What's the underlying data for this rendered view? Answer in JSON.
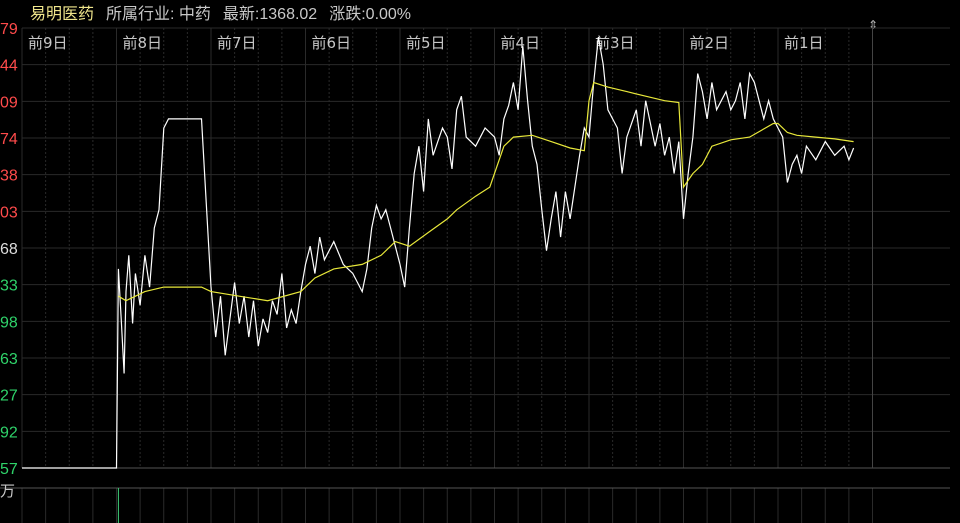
{
  "header": {
    "stock_name": "易明医药",
    "industry": "所属行业: 中药",
    "latest": "最新:1368.02",
    "change": "涨跌:0.00%"
  },
  "volume_unit": "万",
  "icons": {
    "scroll": "up-down-arrow-icon"
  },
  "colors": {
    "price_line": "#ffffff",
    "avg_line": "#e8e83a",
    "axis_up": "#ff4b4b",
    "axis_mid": "#dddddd",
    "axis_down": "#2fd36a",
    "grid": "#2a2a2a",
    "volume_bar": "#3fd17a"
  },
  "chart_data": {
    "type": "line",
    "day_labels": [
      "前9日",
      "前8日",
      "前7日",
      "前6日",
      "前5日",
      "前4日",
      "前3日",
      "前2日",
      "前1日"
    ],
    "y_tick_labels": [
      "79",
      "44",
      "09",
      "74",
      "38",
      "03",
      "68",
      "33",
      "98",
      "63",
      "27",
      "92",
      "57"
    ],
    "series": [
      {
        "key": "price",
        "values": [
          [
            0.0,
            1016
          ],
          [
            0.5,
            1016
          ],
          [
            1.0,
            1016
          ],
          [
            1.02,
            1235
          ],
          [
            1.05,
            1180
          ],
          [
            1.08,
            1120
          ],
          [
            1.1,
            1210
          ],
          [
            1.13,
            1250
          ],
          [
            1.17,
            1175
          ],
          [
            1.2,
            1230
          ],
          [
            1.25,
            1195
          ],
          [
            1.3,
            1250
          ],
          [
            1.35,
            1215
          ],
          [
            1.4,
            1280
          ],
          [
            1.45,
            1300
          ],
          [
            1.5,
            1390
          ],
          [
            1.55,
            1400
          ],
          [
            1.9,
            1400
          ],
          [
            2.0,
            1215
          ],
          [
            2.05,
            1160
          ],
          [
            2.1,
            1205
          ],
          [
            2.15,
            1140
          ],
          [
            2.2,
            1180
          ],
          [
            2.25,
            1220
          ],
          [
            2.3,
            1175
          ],
          [
            2.35,
            1205
          ],
          [
            2.4,
            1160
          ],
          [
            2.45,
            1200
          ],
          [
            2.5,
            1150
          ],
          [
            2.55,
            1180
          ],
          [
            2.6,
            1165
          ],
          [
            2.65,
            1200
          ],
          [
            2.7,
            1185
          ],
          [
            2.75,
            1230
          ],
          [
            2.8,
            1170
          ],
          [
            2.85,
            1190
          ],
          [
            2.9,
            1175
          ],
          [
            2.95,
            1210
          ],
          [
            3.0,
            1240
          ],
          [
            3.05,
            1260
          ],
          [
            3.1,
            1230
          ],
          [
            3.15,
            1270
          ],
          [
            3.2,
            1245
          ],
          [
            3.3,
            1265
          ],
          [
            3.4,
            1240
          ],
          [
            3.5,
            1230
          ],
          [
            3.55,
            1220
          ],
          [
            3.6,
            1210
          ],
          [
            3.65,
            1235
          ],
          [
            3.7,
            1280
          ],
          [
            3.75,
            1305
          ],
          [
            3.8,
            1290
          ],
          [
            3.85,
            1300
          ],
          [
            3.9,
            1280
          ],
          [
            3.95,
            1260
          ],
          [
            4.0,
            1240
          ],
          [
            4.05,
            1215
          ],
          [
            4.1,
            1280
          ],
          [
            4.15,
            1340
          ],
          [
            4.2,
            1370
          ],
          [
            4.25,
            1320
          ],
          [
            4.3,
            1400
          ],
          [
            4.35,
            1360
          ],
          [
            4.4,
            1375
          ],
          [
            4.45,
            1390
          ],
          [
            4.5,
            1380
          ],
          [
            4.55,
            1345
          ],
          [
            4.6,
            1410
          ],
          [
            4.65,
            1425
          ],
          [
            4.7,
            1380
          ],
          [
            4.8,
            1370
          ],
          [
            4.9,
            1390
          ],
          [
            5.0,
            1380
          ],
          [
            5.05,
            1360
          ],
          [
            5.1,
            1400
          ],
          [
            5.15,
            1415
          ],
          [
            5.2,
            1440
          ],
          [
            5.25,
            1410
          ],
          [
            5.3,
            1480
          ],
          [
            5.35,
            1420
          ],
          [
            5.4,
            1370
          ],
          [
            5.45,
            1350
          ],
          [
            5.5,
            1300
          ],
          [
            5.55,
            1255
          ],
          [
            5.6,
            1290
          ],
          [
            5.65,
            1320
          ],
          [
            5.7,
            1270
          ],
          [
            5.75,
            1320
          ],
          [
            5.8,
            1290
          ],
          [
            5.9,
            1360
          ],
          [
            5.95,
            1390
          ],
          [
            6.0,
            1380
          ],
          [
            6.05,
            1440
          ],
          [
            6.1,
            1490
          ],
          [
            6.15,
            1460
          ],
          [
            6.2,
            1410
          ],
          [
            6.3,
            1390
          ],
          [
            6.35,
            1340
          ],
          [
            6.4,
            1380
          ],
          [
            6.5,
            1410
          ],
          [
            6.55,
            1370
          ],
          [
            6.6,
            1420
          ],
          [
            6.7,
            1370
          ],
          [
            6.75,
            1395
          ],
          [
            6.8,
            1360
          ],
          [
            6.85,
            1380
          ],
          [
            6.9,
            1340
          ],
          [
            6.95,
            1375
          ],
          [
            7.0,
            1290
          ],
          [
            7.05,
            1340
          ],
          [
            7.1,
            1380
          ],
          [
            7.15,
            1450
          ],
          [
            7.2,
            1430
          ],
          [
            7.25,
            1400
          ],
          [
            7.3,
            1440
          ],
          [
            7.35,
            1410
          ],
          [
            7.4,
            1420
          ],
          [
            7.45,
            1430
          ],
          [
            7.5,
            1410
          ],
          [
            7.55,
            1420
          ],
          [
            7.6,
            1440
          ],
          [
            7.65,
            1400
          ],
          [
            7.7,
            1450
          ],
          [
            7.75,
            1440
          ],
          [
            7.8,
            1420
          ],
          [
            7.85,
            1400
          ],
          [
            7.9,
            1420
          ],
          [
            7.95,
            1400
          ],
          [
            8.0,
            1390
          ],
          [
            8.05,
            1380
          ],
          [
            8.1,
            1330
          ],
          [
            8.15,
            1350
          ],
          [
            8.2,
            1360
          ],
          [
            8.25,
            1340
          ],
          [
            8.3,
            1370
          ],
          [
            8.4,
            1355
          ],
          [
            8.5,
            1375
          ],
          [
            8.6,
            1360
          ],
          [
            8.7,
            1370
          ],
          [
            8.75,
            1355
          ],
          [
            8.8,
            1368
          ]
        ]
      },
      {
        "key": "average",
        "values": [
          [
            1.02,
            1205
          ],
          [
            1.1,
            1200
          ],
          [
            1.2,
            1205
          ],
          [
            1.3,
            1210
          ],
          [
            1.5,
            1215
          ],
          [
            1.9,
            1215
          ],
          [
            2.0,
            1210
          ],
          [
            2.3,
            1205
          ],
          [
            2.6,
            1200
          ],
          [
            2.95,
            1210
          ],
          [
            3.1,
            1225
          ],
          [
            3.3,
            1235
          ],
          [
            3.6,
            1240
          ],
          [
            3.8,
            1250
          ],
          [
            3.95,
            1265
          ],
          [
            4.1,
            1260
          ],
          [
            4.3,
            1275
          ],
          [
            4.5,
            1290
          ],
          [
            4.6,
            1300
          ],
          [
            4.8,
            1315
          ],
          [
            4.95,
            1325
          ],
          [
            5.0,
            1340
          ],
          [
            5.1,
            1370
          ],
          [
            5.2,
            1380
          ],
          [
            5.4,
            1382
          ],
          [
            5.6,
            1375
          ],
          [
            5.8,
            1368
          ],
          [
            5.95,
            1365
          ],
          [
            6.0,
            1420
          ],
          [
            6.05,
            1440
          ],
          [
            6.2,
            1435
          ],
          [
            6.4,
            1430
          ],
          [
            6.6,
            1425
          ],
          [
            6.8,
            1420
          ],
          [
            6.95,
            1418
          ],
          [
            7.0,
            1325
          ],
          [
            7.1,
            1340
          ],
          [
            7.2,
            1350
          ],
          [
            7.3,
            1370
          ],
          [
            7.5,
            1377
          ],
          [
            7.7,
            1380
          ],
          [
            7.95,
            1395
          ],
          [
            8.0,
            1395
          ],
          [
            8.1,
            1385
          ],
          [
            8.2,
            1382
          ],
          [
            8.4,
            1380
          ],
          [
            8.6,
            1378
          ],
          [
            8.8,
            1375
          ]
        ]
      }
    ],
    "y_range": [
      1016,
      1500
    ],
    "x_range": [
      0,
      9
    ]
  }
}
